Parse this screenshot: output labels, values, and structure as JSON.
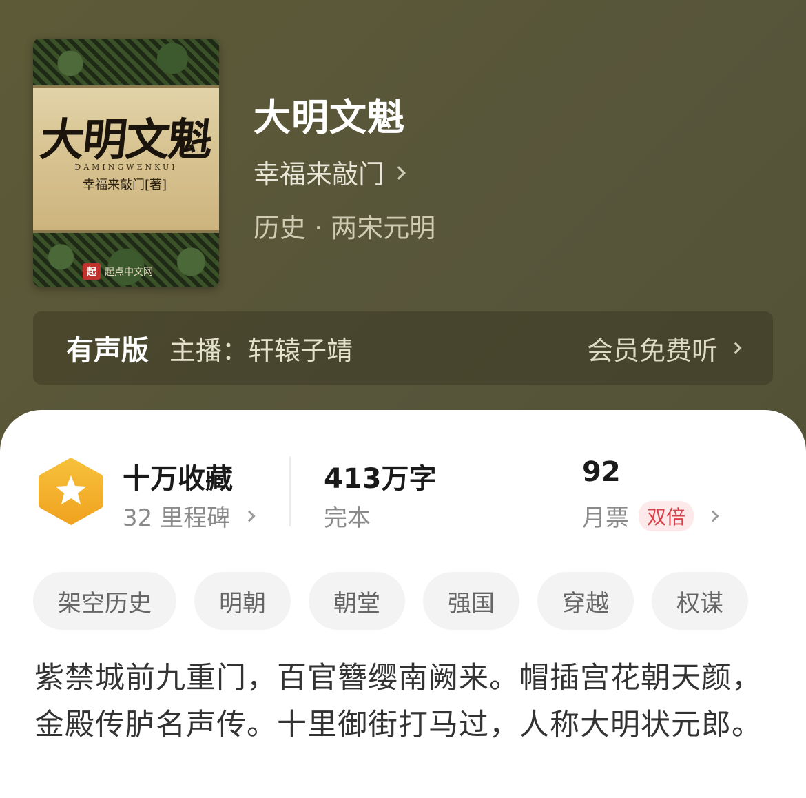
{
  "book": {
    "title": "大明文魁",
    "author": "幸福来敲门",
    "category": "历史 · 两宋元明"
  },
  "cover": {
    "title": "大明文魁",
    "pinyin": "DAMINGWENKUI",
    "author_text": "幸福来敲门[著]",
    "publisher_mark": "起",
    "publisher_name": "起点中文网"
  },
  "audio": {
    "label": "有声版",
    "host": "主播：轩辕子靖",
    "cta": "会员免费听"
  },
  "stats": {
    "collection_title": "十万收藏",
    "collection_sub": "32 里程碑",
    "words_title": "413万字",
    "words_sub": "完本",
    "ticket_title": "92",
    "ticket_sub": "月票",
    "ticket_tag": "双倍"
  },
  "tags": [
    "架空历史",
    "明朝",
    "朝堂",
    "强国",
    "穿越",
    "权谋"
  ],
  "synopsis": "紫禁城前九重门，百官簪缨南阙来。帽插宫花朝天颜，金殿传胪名声传。十里御街打马过，人称大明状元郎。",
  "colors": {
    "header_bg": "#5a5735",
    "badge_orange": "#f5b32e",
    "double_tag": "#d9414a"
  }
}
